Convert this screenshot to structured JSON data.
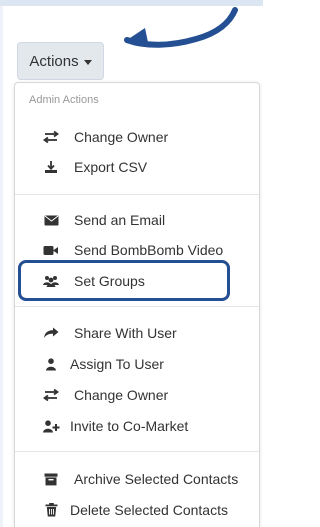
{
  "toolbar": {
    "actions_label": "Actions",
    "actions_caret_icon": "caret-down-icon",
    "callout_arrow_color": "#244f93",
    "highlight_color": "#244f93"
  },
  "dropdown": {
    "header": "Admin Actions",
    "items": [
      {
        "label": "Change Owner",
        "icon": "swap-arrows-icon"
      },
      {
        "label": "Export CSV",
        "icon": "download-icon"
      },
      {
        "label": "Send an Email",
        "icon": "envelope-icon"
      },
      {
        "label": "Send BombBomb Video",
        "icon": "video-camera-icon"
      },
      {
        "label": "Set Groups",
        "icon": "users-icon"
      },
      {
        "label": "Share With User",
        "icon": "share-arrow-icon"
      },
      {
        "label": "Assign To User",
        "icon": "user-icon"
      },
      {
        "label": "Change Owner",
        "icon": "swap-arrows-icon"
      },
      {
        "label": "Invite to Co-Market",
        "icon": "user-plus-icon"
      },
      {
        "label": "Archive Selected Contacts",
        "icon": "archive-icon"
      },
      {
        "label": "Delete Selected Contacts",
        "icon": "trash-icon"
      }
    ]
  }
}
